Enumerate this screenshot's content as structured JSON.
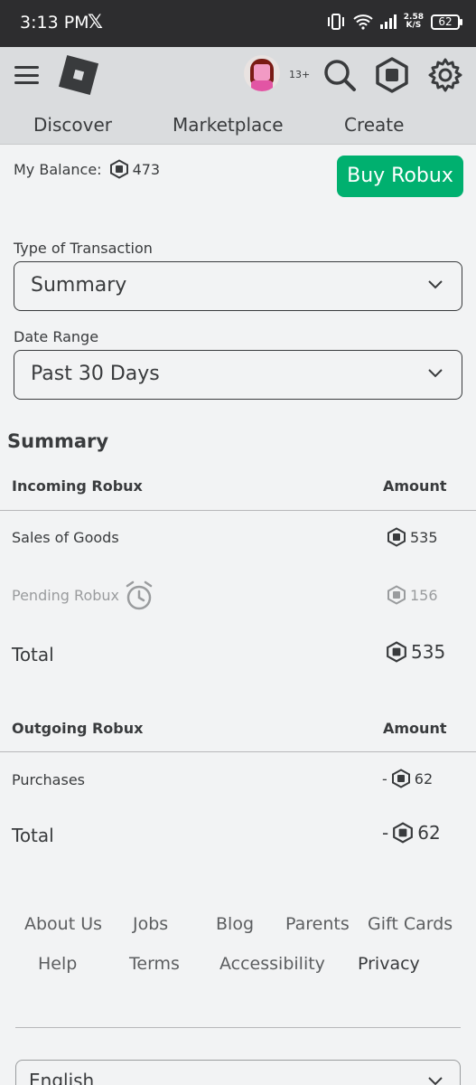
{
  "status_bar": {
    "time": "3:13 PM",
    "x_logo": "𝕏",
    "speed_value": "2.58",
    "speed_unit": "K/S",
    "battery": "62"
  },
  "header": {
    "age_label": "13+",
    "tabs": [
      "Discover",
      "Marketplace",
      "Create"
    ]
  },
  "balance": {
    "label": "My Balance:",
    "value": "473",
    "buy_button": "Buy Robux"
  },
  "filters": {
    "transaction_label": "Type of Transaction",
    "transaction_value": "Summary",
    "date_label": "Date Range",
    "date_value": "Past 30 Days"
  },
  "summary": {
    "title": "Summary",
    "incoming": {
      "header": "Incoming Robux",
      "amount_header": "Amount",
      "rows": [
        {
          "label": "Sales of Goods",
          "value": "535"
        },
        {
          "label": "Pending Robux",
          "value": "156"
        }
      ],
      "total_label": "Total",
      "total_value": "535"
    },
    "outgoing": {
      "header": "Outgoing Robux",
      "amount_header": "Amount",
      "rows": [
        {
          "label": "Purchases",
          "sign": "-",
          "value": "62"
        }
      ],
      "total_label": "Total",
      "total_sign": "-",
      "total_value": "62"
    }
  },
  "footer": {
    "links": [
      "About Us",
      "Jobs",
      "Blog",
      "Parents",
      "Gift Cards",
      "Help",
      "Terms",
      "Accessibility",
      "Privacy"
    ],
    "language": "English"
  },
  "colors": {
    "accent_green": "#00b06f",
    "header_bg": "#dadcde",
    "text": "#393b3d"
  },
  "icons": [
    "robux-icon",
    "search-icon",
    "settings-icon",
    "alarm-icon",
    "chevron-down-icon"
  ]
}
